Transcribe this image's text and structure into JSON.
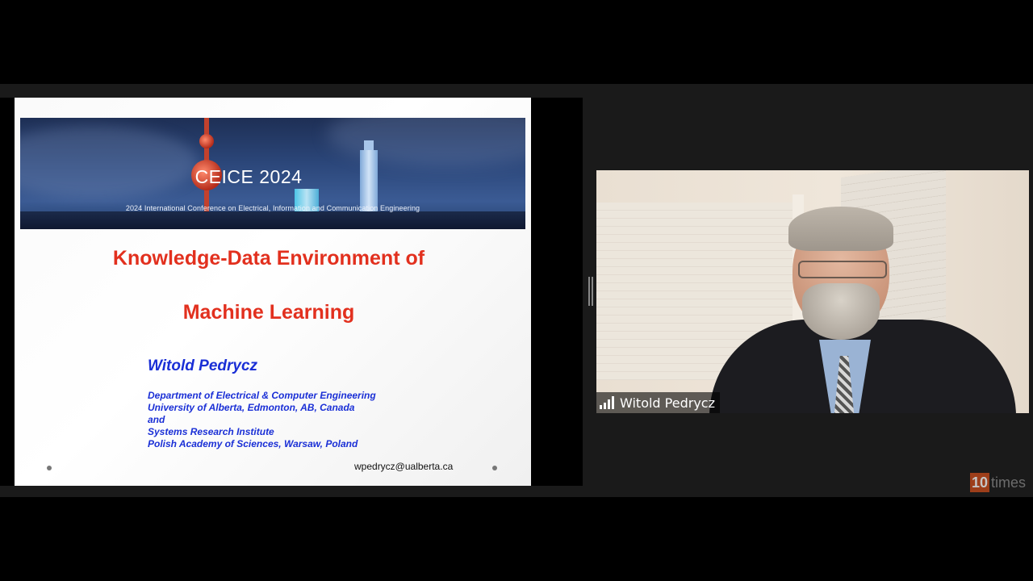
{
  "slide": {
    "banner_title": "CEICE 2024",
    "banner_subtitle": "2024 International Conference on Electrical, Information and Communication Engineering",
    "title_line1": "Knowledge-Data Environment of",
    "title_line2": "Machine Learning",
    "author": "Witold Pedrycz",
    "affiliation": [
      "Department of Electrical & Computer Engineering",
      "University of Alberta, Edmonton, AB, Canada",
      "and",
      "Systems Research Institute",
      "Polish Academy of Sciences, Warsaw, Poland"
    ],
    "email": "wpedrycz@ualberta.ca"
  },
  "participant": {
    "name": "Witold Pedrycz",
    "signal_bars": 4
  },
  "watermark": {
    "number": "10",
    "text": "times"
  }
}
